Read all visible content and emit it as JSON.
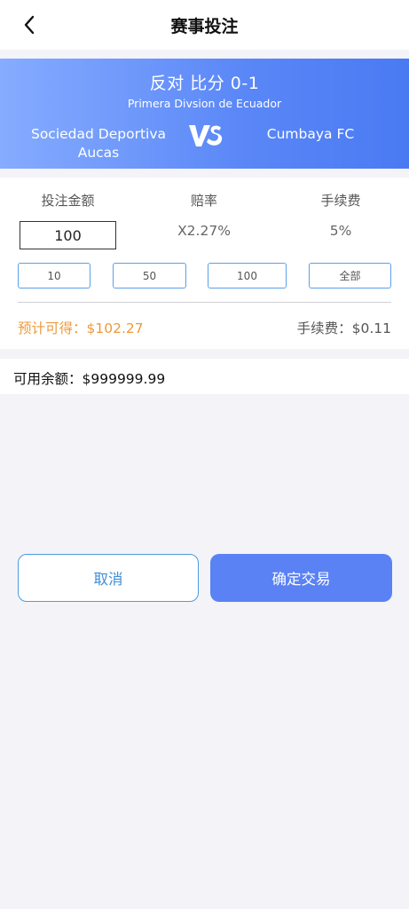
{
  "header": {
    "title": "赛事投注",
    "back_icon": "chevron-left-icon"
  },
  "match": {
    "bet_title": "反对 比分 0-1",
    "league": "Primera Divsion de Ecuador",
    "home_team": "Sociedad Deportiva Aucas",
    "away_team": "Cumbaya FC",
    "vs_icon": "vs-icon"
  },
  "bet": {
    "amount_label": "投注金额",
    "odds_label": "赔率",
    "fee_label": "手续费",
    "amount_value": "100",
    "odds_value": "X2.27%",
    "fee_value": "5%",
    "quick_amounts": [
      "10",
      "50",
      "100",
      "全部"
    ],
    "expected_text": "预计可得：$102.27",
    "fee_text": "手续费：$0.11"
  },
  "balance": {
    "text": "可用余额：$999999.99"
  },
  "actions": {
    "cancel_label": "取消",
    "confirm_label": "确定交易"
  },
  "colors": {
    "banner_start": "#86acff",
    "banner_end": "#4a7af3",
    "accent_orange": "#ee9a3a",
    "confirm_button": "#5a82f5",
    "outline_blue": "#4a9de0"
  }
}
